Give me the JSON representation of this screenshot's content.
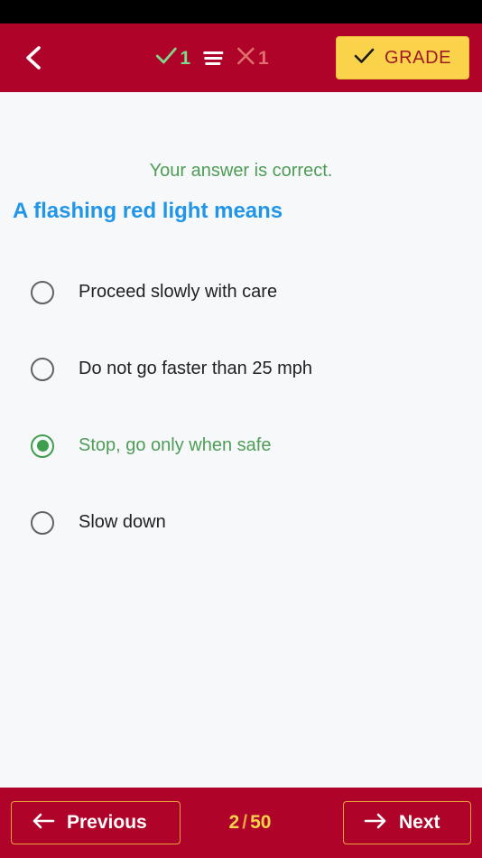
{
  "header": {
    "back_icon": "chevron-left-icon",
    "score_correct": "1",
    "score_correct_icon": "check-icon",
    "list_icon": "list-icon",
    "score_wrong": "1",
    "score_wrong_icon": "x-icon",
    "grade_label": "GRADE",
    "grade_icon": "check-icon",
    "background_color": "#B0032A",
    "grade_bg_color": "#FBD34B",
    "grade_text_color": "#9E1B23",
    "correct_color": "#7ED98A",
    "wrong_color": "#E0706E"
  },
  "main": {
    "feedback": "Your answer is correct.",
    "feedback_color": "#4E9D57",
    "question": "A flashing red light means",
    "question_color": "#2196E8",
    "options": [
      {
        "label": "Proceed slowly with care",
        "selected": false
      },
      {
        "label": "Do not go faster than 25 mph",
        "selected": false
      },
      {
        "label": "Stop, go only when safe",
        "selected": true
      },
      {
        "label": "Slow down",
        "selected": false
      }
    ],
    "selected_color": "#3F9E4D"
  },
  "footer": {
    "previous_label": "Previous",
    "previous_icon": "arrow-left-icon",
    "next_label": "Next",
    "next_icon": "arrow-right-icon",
    "current_page": "2",
    "separator": "/",
    "total_pages": "50",
    "background_color": "#B0032A",
    "border_color": "#E8A33D",
    "counter_color": "#FBD34B"
  }
}
